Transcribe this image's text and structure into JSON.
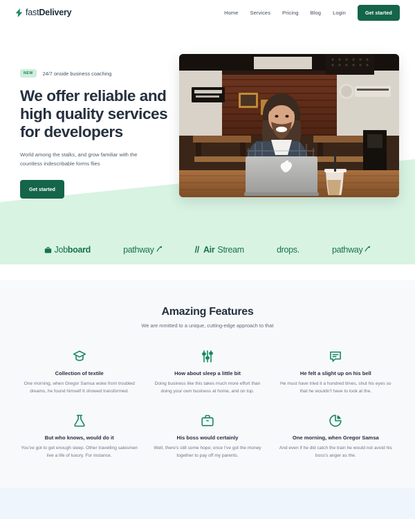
{
  "header": {
    "logo": {
      "icon": "lightning-bolt-icon",
      "text_light": "fast",
      "text_bold": "Delivery"
    },
    "nav_links": [
      {
        "label": "Home"
      },
      {
        "label": "Services"
      },
      {
        "label": "Pricing"
      },
      {
        "label": "Blog"
      },
      {
        "label": "Login"
      }
    ],
    "cta_label": "Get started"
  },
  "hero": {
    "badge_tag": "NEW",
    "badge_caption": "24/7 onside business coaching",
    "title": "We offer reliable and high quality services for developers",
    "description": "World among the stalks, and grow familiar with the countless indescribable forms flies",
    "cta_label": "Get started",
    "image_alt": "man-at-laptop-in-cafe-photo"
  },
  "brands": [
    {
      "name": "Jobboard",
      "icon": "briefcase-icon",
      "text_light": "Job",
      "text_bold": "board"
    },
    {
      "name": "pathway",
      "icon": "arrow-up-right-icon",
      "text": "pathway"
    },
    {
      "name": "AirStream",
      "prefix": "//",
      "text_bold": "Air",
      "text_light": "Stream"
    },
    {
      "name": "drops.",
      "text": "drops."
    },
    {
      "name": "pathway",
      "icon": "arrow-up-right-icon",
      "text": "pathway"
    }
  ],
  "features": {
    "title": "Amazing Features",
    "subtitle": "We are mmitted to a unique, cutting-edge approach to that",
    "items": [
      {
        "icon": "graduation-cap-icon",
        "title": "Collection of textile",
        "description": "One morning, when Gregor Samsa woke from troubled dreams, he found himself It showed transformed."
      },
      {
        "icon": "sliders-icon",
        "title": "How about sleep a little bit",
        "description": "Doing business like this takes much more effort than doing your own business at home, and on top."
      },
      {
        "icon": "message-bubble-icon",
        "title": "He felt a slight up on his bell",
        "description": "He must have tried it a hundred times, shut his eyes so that he wouldn't have to look at the."
      },
      {
        "icon": "flask-icon",
        "title": "But who knows, would do it",
        "description": "You've got to get enough sleep. Other travelling salesmen live a life of luxury. For instance."
      },
      {
        "icon": "briefcase-icon",
        "title": "His boss would certainly",
        "description": "Well, there's still some hope; once I've got the money together to pay off my parents."
      },
      {
        "icon": "pie-chart-icon",
        "title": "One morning, when Gregor Samsa",
        "description": "And even if he did catch the train he would not avoid his boss's anger as the."
      }
    ]
  },
  "colors": {
    "brand_green": "#14654a",
    "accent_green": "#17734f",
    "band_green": "#d8f3e2",
    "badge_green": "#cdeedd",
    "heading_dark": "#26303f",
    "features_bg": "#f8f9fb",
    "footer_bg": "#eff5fd"
  }
}
